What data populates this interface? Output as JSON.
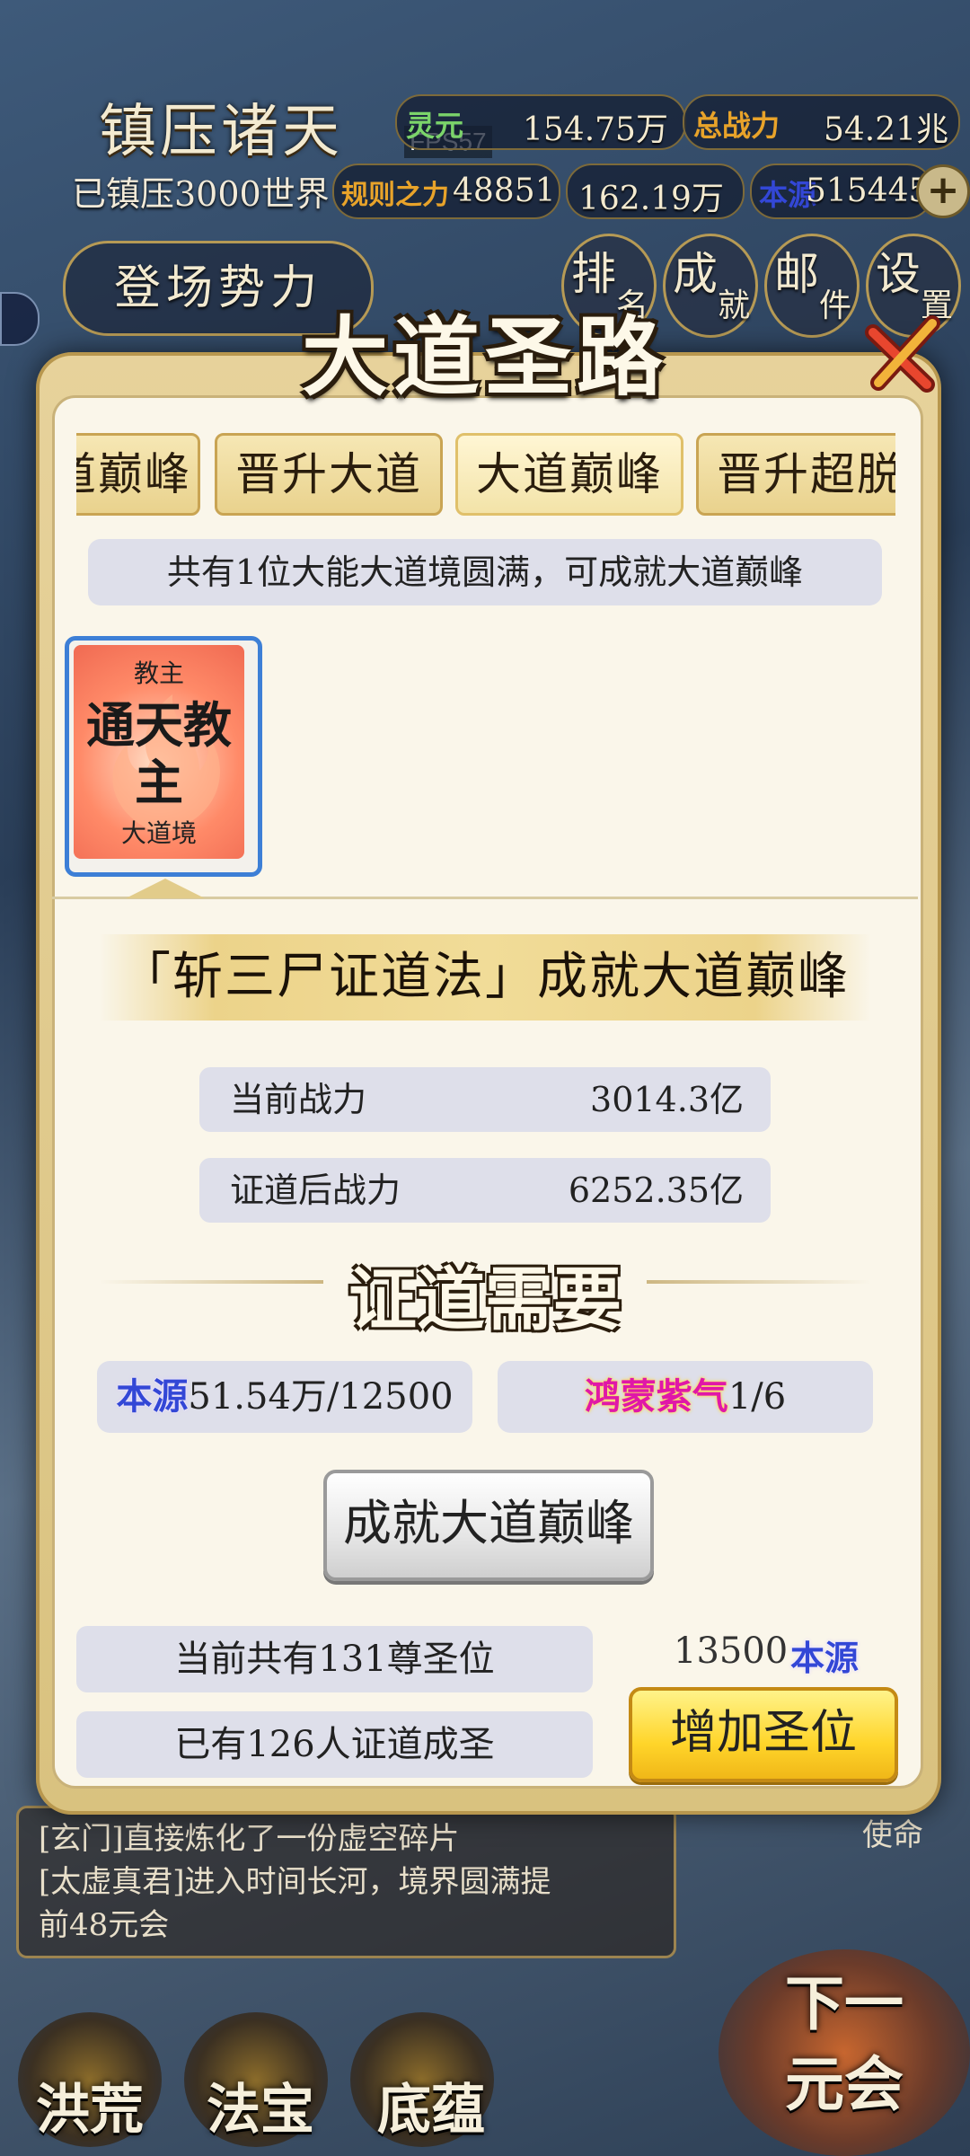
{
  "hud": {
    "title": "镇压诸天",
    "subtitle": "已镇压3000世界",
    "fps": "FPS57",
    "lingyuan_label": "灵元",
    "lingyuan_value": "154.75万",
    "zhanli_label": "总战力",
    "zhanli_value": "54.21兆",
    "guize_label": "规则之力",
    "guize_value": "48851",
    "x_value": "162.19万",
    "benyuan_label": "本源",
    "benyuan_value": "515445",
    "faction_button": "登场势力",
    "top_buttons": [
      {
        "big": "排",
        "small": "名"
      },
      {
        "big": "成",
        "small": "就"
      },
      {
        "big": "邮",
        "small": "件"
      },
      {
        "big": "设",
        "small": "置"
      }
    ]
  },
  "news": {
    "line1": "[玄门]直接炼化了一份虚空碎片",
    "line2": "[太虚真君]进入时间长河，境界圆满提",
    "line3": "前48元会",
    "mission": "使命"
  },
  "bottom_nav": [
    "洪荒",
    "法宝",
    "底蕴"
  ],
  "next_button": "下一元会",
  "modal": {
    "title": "大道圣路",
    "tabs": [
      "大道巅峰",
      "晋升大道",
      "大道巅峰",
      "晋升超脱"
    ],
    "active_tab_index": 2,
    "info": "共有1位大能大道境圆满，可成就大道巅峰",
    "card": {
      "rank": "教主",
      "name": "通天教主",
      "realm": "大道境"
    },
    "method": "「斩三尸证道法」成就大道巅峰",
    "current_power_label": "当前战力",
    "current_power_value": "3014.3亿",
    "after_power_label": "证道后战力",
    "after_power_value": "6252.35亿",
    "requirements_title": "证道需要",
    "req1_tag": "本源",
    "req1_value": "51.54万/12500",
    "req2_tag": "鸿蒙紫气",
    "req2_value": "1/6",
    "achieve_button": "成就大道巅峰",
    "seats_total": "当前共有131尊圣位",
    "seats_used": "已有126人证道成圣",
    "cost_value": "13500",
    "cost_tag": "本源",
    "add_button": "增加圣位"
  },
  "colors": {
    "accent_gold": "#e9d28d",
    "card_border": "#3d7fd6",
    "add_button": "#ffd52a",
    "benyuan_tag": "#3347d6",
    "hongmeng_tag": "#e018a8"
  }
}
